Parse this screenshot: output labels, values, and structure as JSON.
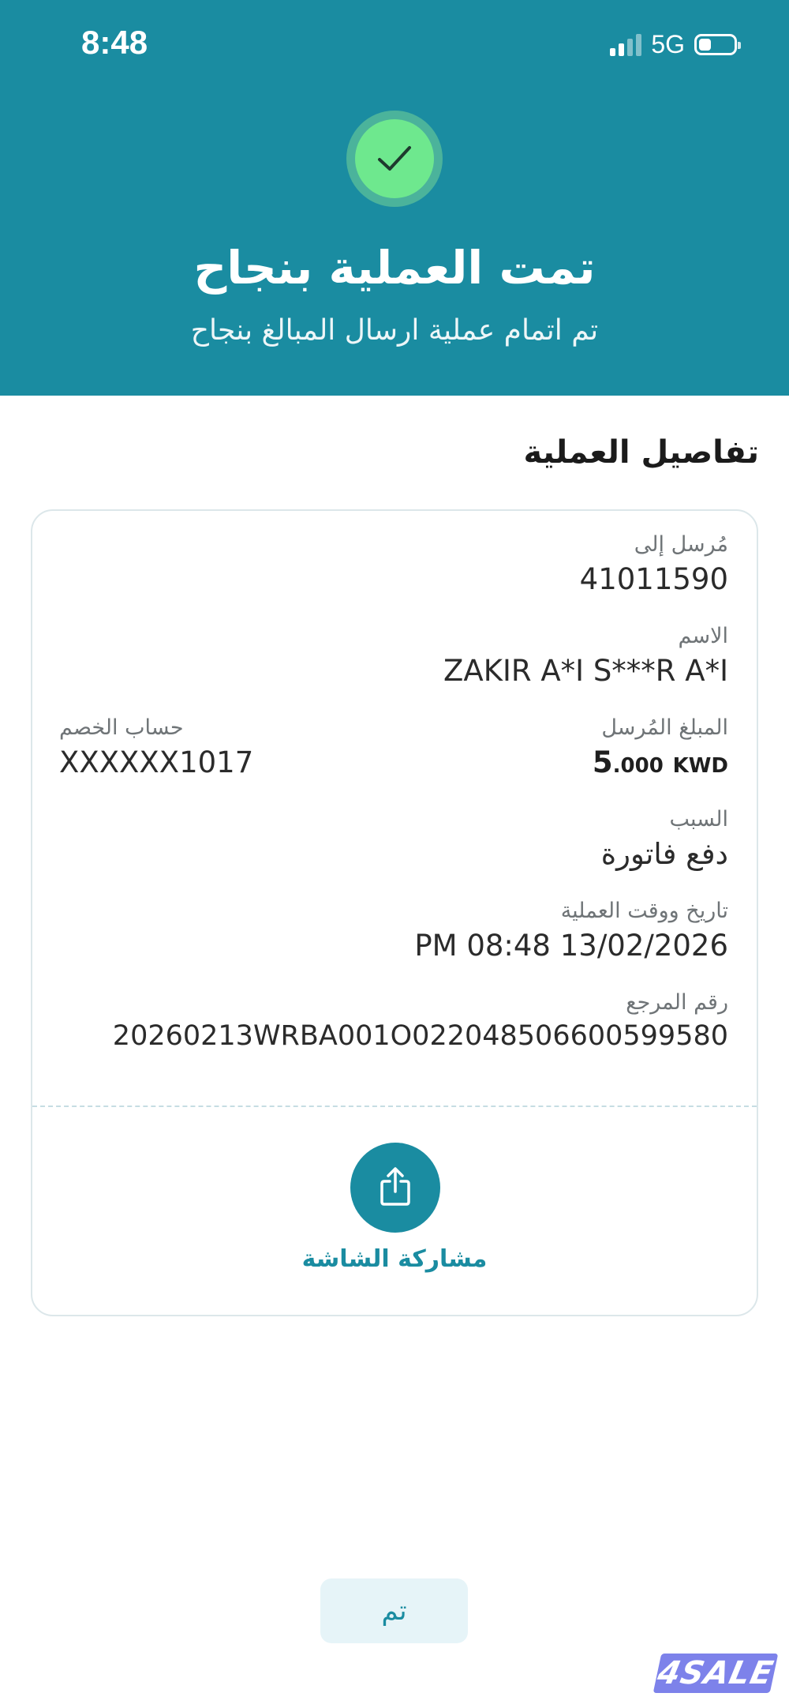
{
  "status_bar": {
    "time": "8:48",
    "network": "5G",
    "signal_bars_active": 2,
    "signal_bars_total": 4,
    "battery_level": 0.25
  },
  "header": {
    "title": "تمت العملية بنجاح",
    "subtitle": "تم اتمام عملية ارسال المبالغ بنجاح",
    "icon": "check-icon",
    "color": "#1a8ca1",
    "success_color": "#6ee88e"
  },
  "details": {
    "section_title": "تفاصيل العملية",
    "sent_to_label": "مُرسل إلى",
    "sent_to_value": "41011590",
    "name_label": "الاسم",
    "name_value": "ZAKIR A*I S***R A*I",
    "debit_account_label": "حساب الخصم",
    "debit_account_value": "XXXXXX1017",
    "amount_label": "المبلغ المُرسل",
    "amount_integer": "5",
    "amount_decimal": ".000",
    "amount_currency": "KWD",
    "reason_label": "السبب",
    "reason_value": "دفع فاتورة",
    "datetime_label": "تاريخ ووقت العملية",
    "datetime_value": "13/02/2026 08:48 PM",
    "reference_label": "رقم المرجع",
    "reference_value": "20260213WRBA001O022048506600599580"
  },
  "share": {
    "label": "مشاركة الشاشة",
    "icon": "share-icon"
  },
  "done_button": {
    "label": "تم"
  },
  "watermark": {
    "text": "4SALE"
  }
}
